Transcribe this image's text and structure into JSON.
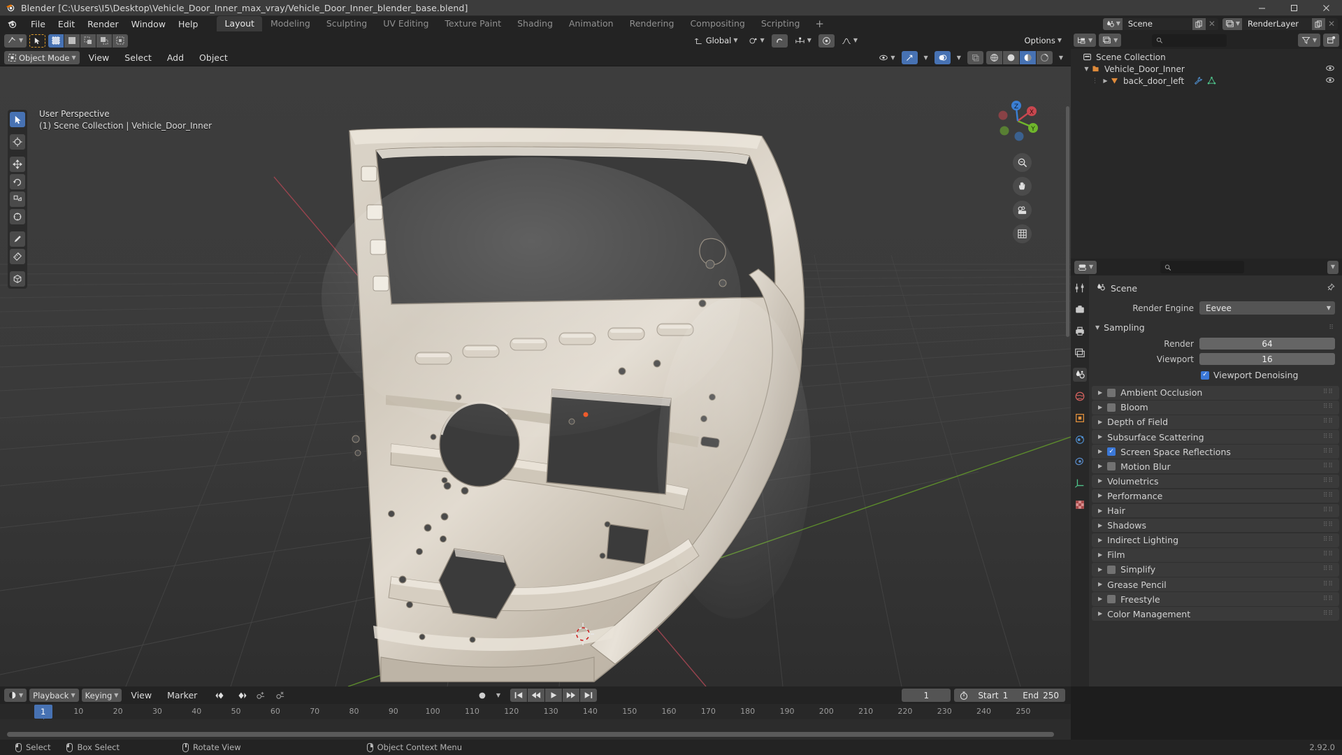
{
  "window": {
    "title": "Blender [C:\\Users\\I5\\Desktop\\Vehicle_Door_Inner_max_vray/Vehicle_Door_Inner_blender_base.blend]",
    "minimize": "–",
    "maximize": "☐",
    "close": "✕"
  },
  "topbar": {
    "menus": [
      "File",
      "Edit",
      "Render",
      "Window",
      "Help"
    ],
    "workspaces": [
      "Layout",
      "Modeling",
      "Sculpting",
      "UV Editing",
      "Texture Paint",
      "Shading",
      "Animation",
      "Rendering",
      "Compositing",
      "Scripting"
    ],
    "active_workspace": "Layout",
    "add_workspace": "+",
    "scene_name": "Scene",
    "view_layer_name": "RenderLayer"
  },
  "viewport": {
    "mode": "Object Mode",
    "menus": [
      "View",
      "Select",
      "Add",
      "Object"
    ],
    "transform_orientation": "Global",
    "options_label": "Options",
    "overlay_line1": "User Perspective",
    "overlay_line2": "(1) Scene Collection | Vehicle_Door_Inner",
    "gizmo_axes": [
      "X",
      "Y",
      "Z"
    ],
    "tools": [
      "tweak-select-tool",
      "cursor-tool",
      "move-tool",
      "rotate-tool",
      "scale-tool",
      "transform-tool",
      "annotate-tool",
      "measure-tool",
      "add-cube-tool"
    ]
  },
  "outliner": {
    "search_placeholder": "",
    "display_mode": "View Layer",
    "rows": [
      {
        "label": "Scene Collection",
        "indent": 0,
        "icon": "collection-icon",
        "expander": "",
        "eye": false
      },
      {
        "label": "Vehicle_Door_Inner",
        "indent": 1,
        "icon": "collection-orange-icon",
        "expander": "▼",
        "eye": true
      },
      {
        "label": "back_door_left",
        "indent": 2,
        "icon": "mesh-object-icon",
        "expander": "▶",
        "eye": true
      }
    ]
  },
  "properties": {
    "context_title": "Scene",
    "search_placeholder": "",
    "render_engine_label": "Render Engine",
    "render_engine_value": "Eevee",
    "sampling_label": "Sampling",
    "render_samples_label": "Render",
    "render_samples_value": "64",
    "viewport_samples_label": "Viewport",
    "viewport_samples_value": "16",
    "viewport_denoising_label": "Viewport Denoising",
    "viewport_denoising_checked": true,
    "panels": [
      {
        "label": "Ambient Occlusion",
        "checkbox": true,
        "checked": false
      },
      {
        "label": "Bloom",
        "checkbox": true,
        "checked": false
      },
      {
        "label": "Depth of Field",
        "checkbox": false,
        "checked": false
      },
      {
        "label": "Subsurface Scattering",
        "checkbox": false,
        "checked": false
      },
      {
        "label": "Screen Space Reflections",
        "checkbox": true,
        "checked": true
      },
      {
        "label": "Motion Blur",
        "checkbox": true,
        "checked": false
      },
      {
        "label": "Volumetrics",
        "checkbox": false,
        "checked": false
      },
      {
        "label": "Performance",
        "checkbox": false,
        "checked": false
      },
      {
        "label": "Hair",
        "checkbox": false,
        "checked": false
      },
      {
        "label": "Shadows",
        "checkbox": false,
        "checked": false
      },
      {
        "label": "Indirect Lighting",
        "checkbox": false,
        "checked": false
      },
      {
        "label": "Film",
        "checkbox": false,
        "checked": false
      },
      {
        "label": "Simplify",
        "checkbox": true,
        "checked": false
      },
      {
        "label": "Grease Pencil",
        "checkbox": false,
        "checked": false
      },
      {
        "label": "Freestyle",
        "checkbox": true,
        "checked": false
      },
      {
        "label": "Color Management",
        "checkbox": false,
        "checked": false
      }
    ]
  },
  "timeline": {
    "menus": [
      "Playback",
      "Keying",
      "View",
      "Marker"
    ],
    "current_frame": "1",
    "start_label": "Start",
    "start_value": "1",
    "end_label": "End",
    "end_value": "250",
    "ticks": [
      "10",
      "20",
      "30",
      "40",
      "50",
      "60",
      "70",
      "80",
      "90",
      "100",
      "110",
      "120",
      "130",
      "140",
      "150",
      "160",
      "170",
      "180",
      "190",
      "200",
      "210",
      "220",
      "230",
      "240",
      "250"
    ],
    "playhead_label": "1"
  },
  "statusbar": {
    "items": [
      {
        "mouse": "left",
        "label": "Select"
      },
      {
        "mouse": "left-drag",
        "label": "Box Select"
      },
      {
        "mouse": "middle",
        "label": "Rotate View"
      },
      {
        "mouse": "right",
        "label": "Object Context Menu"
      }
    ],
    "version": "2.92.0"
  },
  "colors": {
    "accent_blue": "#4772b3",
    "header_bg": "#232323",
    "panel_bg": "#303030",
    "outliner_bg": "#282828",
    "viewport_bg": "#393939",
    "axis_x_red": "#cc4352",
    "axis_y_green": "#6fb62c",
    "orange": "#e08b3a"
  }
}
